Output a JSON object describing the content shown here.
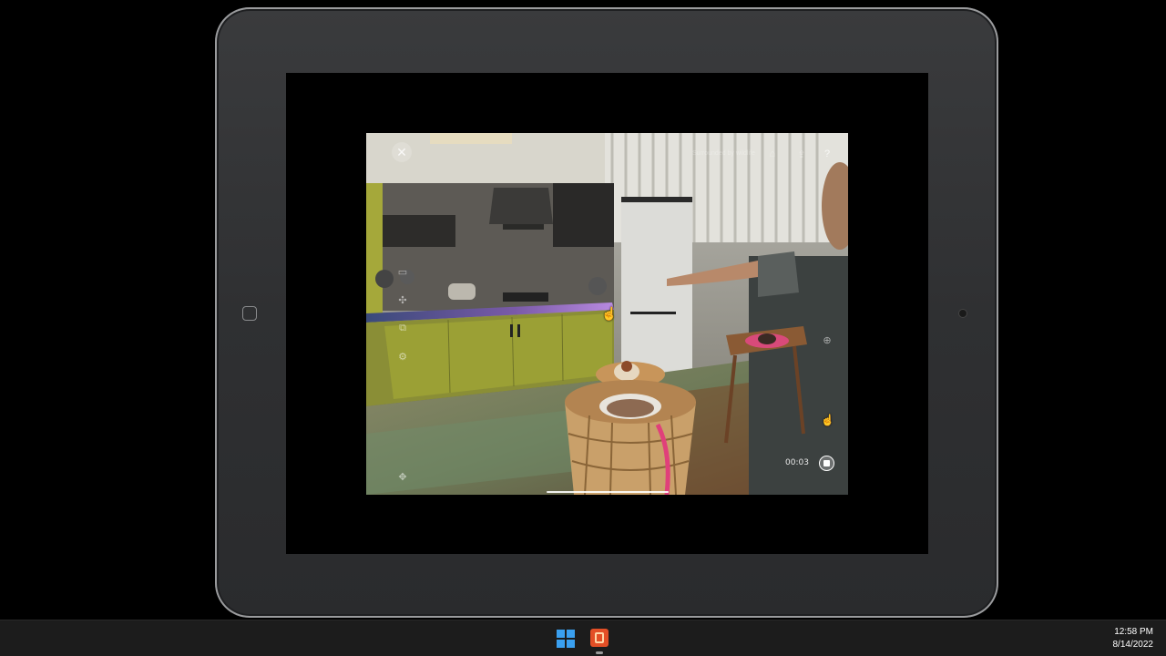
{
  "ar_app": {
    "close_icon": "close-icon",
    "top_caption": "Surrounded by wildlife",
    "help_label": "?",
    "share_label": "⇪",
    "home_label": "⌂",
    "timer": "00:03",
    "side_tools": [
      "copy-icon",
      "settings-icon",
      "move-icon"
    ]
  },
  "taskbar": {
    "start_icon": "windows-start-icon",
    "pinned_app_icon": "app-icon",
    "time": "12:58 PM",
    "date": "8/14/2022"
  },
  "colors": {
    "taskbar_bg": "#1c1c1c",
    "start_blue": "#3aa0f0",
    "app_orange": "#e34f26",
    "tablet_frame": "#2f3032"
  }
}
